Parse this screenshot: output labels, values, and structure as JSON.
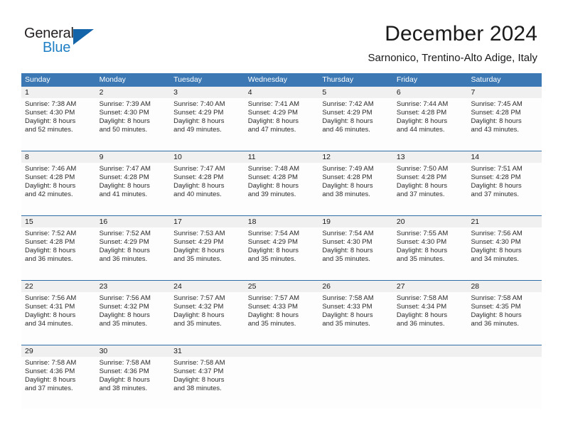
{
  "brand": {
    "name_part1": "General",
    "name_part2": "Blue",
    "triangle_icon": "blue-triangle-icon",
    "colors": {
      "dark": "#231f20",
      "blue": "#1f7fc4",
      "triangle": "#1464aa"
    }
  },
  "header": {
    "title": "December 2024",
    "subtitle": "Sarnonico, Trentino-Alto Adige, Italy"
  },
  "calendar": {
    "accent_color": "#3c79b4",
    "numberband_color": "#f0f0f0",
    "weekdays": [
      "Sunday",
      "Monday",
      "Tuesday",
      "Wednesday",
      "Thursday",
      "Friday",
      "Saturday"
    ],
    "weeks": [
      [
        {
          "day": "1",
          "sunrise": "Sunrise: 7:38 AM",
          "sunset": "Sunset: 4:30 PM",
          "daylight_line1": "Daylight: 8 hours",
          "daylight_line2": "and 52 minutes."
        },
        {
          "day": "2",
          "sunrise": "Sunrise: 7:39 AM",
          "sunset": "Sunset: 4:30 PM",
          "daylight_line1": "Daylight: 8 hours",
          "daylight_line2": "and 50 minutes."
        },
        {
          "day": "3",
          "sunrise": "Sunrise: 7:40 AM",
          "sunset": "Sunset: 4:29 PM",
          "daylight_line1": "Daylight: 8 hours",
          "daylight_line2": "and 49 minutes."
        },
        {
          "day": "4",
          "sunrise": "Sunrise: 7:41 AM",
          "sunset": "Sunset: 4:29 PM",
          "daylight_line1": "Daylight: 8 hours",
          "daylight_line2": "and 47 minutes."
        },
        {
          "day": "5",
          "sunrise": "Sunrise: 7:42 AM",
          "sunset": "Sunset: 4:29 PM",
          "daylight_line1": "Daylight: 8 hours",
          "daylight_line2": "and 46 minutes."
        },
        {
          "day": "6",
          "sunrise": "Sunrise: 7:44 AM",
          "sunset": "Sunset: 4:28 PM",
          "daylight_line1": "Daylight: 8 hours",
          "daylight_line2": "and 44 minutes."
        },
        {
          "day": "7",
          "sunrise": "Sunrise: 7:45 AM",
          "sunset": "Sunset: 4:28 PM",
          "daylight_line1": "Daylight: 8 hours",
          "daylight_line2": "and 43 minutes."
        }
      ],
      [
        {
          "day": "8",
          "sunrise": "Sunrise: 7:46 AM",
          "sunset": "Sunset: 4:28 PM",
          "daylight_line1": "Daylight: 8 hours",
          "daylight_line2": "and 42 minutes."
        },
        {
          "day": "9",
          "sunrise": "Sunrise: 7:47 AM",
          "sunset": "Sunset: 4:28 PM",
          "daylight_line1": "Daylight: 8 hours",
          "daylight_line2": "and 41 minutes."
        },
        {
          "day": "10",
          "sunrise": "Sunrise: 7:47 AM",
          "sunset": "Sunset: 4:28 PM",
          "daylight_line1": "Daylight: 8 hours",
          "daylight_line2": "and 40 minutes."
        },
        {
          "day": "11",
          "sunrise": "Sunrise: 7:48 AM",
          "sunset": "Sunset: 4:28 PM",
          "daylight_line1": "Daylight: 8 hours",
          "daylight_line2": "and 39 minutes."
        },
        {
          "day": "12",
          "sunrise": "Sunrise: 7:49 AM",
          "sunset": "Sunset: 4:28 PM",
          "daylight_line1": "Daylight: 8 hours",
          "daylight_line2": "and 38 minutes."
        },
        {
          "day": "13",
          "sunrise": "Sunrise: 7:50 AM",
          "sunset": "Sunset: 4:28 PM",
          "daylight_line1": "Daylight: 8 hours",
          "daylight_line2": "and 37 minutes."
        },
        {
          "day": "14",
          "sunrise": "Sunrise: 7:51 AM",
          "sunset": "Sunset: 4:28 PM",
          "daylight_line1": "Daylight: 8 hours",
          "daylight_line2": "and 37 minutes."
        }
      ],
      [
        {
          "day": "15",
          "sunrise": "Sunrise: 7:52 AM",
          "sunset": "Sunset: 4:28 PM",
          "daylight_line1": "Daylight: 8 hours",
          "daylight_line2": "and 36 minutes."
        },
        {
          "day": "16",
          "sunrise": "Sunrise: 7:52 AM",
          "sunset": "Sunset: 4:29 PM",
          "daylight_line1": "Daylight: 8 hours",
          "daylight_line2": "and 36 minutes."
        },
        {
          "day": "17",
          "sunrise": "Sunrise: 7:53 AM",
          "sunset": "Sunset: 4:29 PM",
          "daylight_line1": "Daylight: 8 hours",
          "daylight_line2": "and 35 minutes."
        },
        {
          "day": "18",
          "sunrise": "Sunrise: 7:54 AM",
          "sunset": "Sunset: 4:29 PM",
          "daylight_line1": "Daylight: 8 hours",
          "daylight_line2": "and 35 minutes."
        },
        {
          "day": "19",
          "sunrise": "Sunrise: 7:54 AM",
          "sunset": "Sunset: 4:30 PM",
          "daylight_line1": "Daylight: 8 hours",
          "daylight_line2": "and 35 minutes."
        },
        {
          "day": "20",
          "sunrise": "Sunrise: 7:55 AM",
          "sunset": "Sunset: 4:30 PM",
          "daylight_line1": "Daylight: 8 hours",
          "daylight_line2": "and 35 minutes."
        },
        {
          "day": "21",
          "sunrise": "Sunrise: 7:56 AM",
          "sunset": "Sunset: 4:30 PM",
          "daylight_line1": "Daylight: 8 hours",
          "daylight_line2": "and 34 minutes."
        }
      ],
      [
        {
          "day": "22",
          "sunrise": "Sunrise: 7:56 AM",
          "sunset": "Sunset: 4:31 PM",
          "daylight_line1": "Daylight: 8 hours",
          "daylight_line2": "and 34 minutes."
        },
        {
          "day": "23",
          "sunrise": "Sunrise: 7:56 AM",
          "sunset": "Sunset: 4:32 PM",
          "daylight_line1": "Daylight: 8 hours",
          "daylight_line2": "and 35 minutes."
        },
        {
          "day": "24",
          "sunrise": "Sunrise: 7:57 AM",
          "sunset": "Sunset: 4:32 PM",
          "daylight_line1": "Daylight: 8 hours",
          "daylight_line2": "and 35 minutes."
        },
        {
          "day": "25",
          "sunrise": "Sunrise: 7:57 AM",
          "sunset": "Sunset: 4:33 PM",
          "daylight_line1": "Daylight: 8 hours",
          "daylight_line2": "and 35 minutes."
        },
        {
          "day": "26",
          "sunrise": "Sunrise: 7:58 AM",
          "sunset": "Sunset: 4:33 PM",
          "daylight_line1": "Daylight: 8 hours",
          "daylight_line2": "and 35 minutes."
        },
        {
          "day": "27",
          "sunrise": "Sunrise: 7:58 AM",
          "sunset": "Sunset: 4:34 PM",
          "daylight_line1": "Daylight: 8 hours",
          "daylight_line2": "and 36 minutes."
        },
        {
          "day": "28",
          "sunrise": "Sunrise: 7:58 AM",
          "sunset": "Sunset: 4:35 PM",
          "daylight_line1": "Daylight: 8 hours",
          "daylight_line2": "and 36 minutes."
        }
      ],
      [
        {
          "day": "29",
          "sunrise": "Sunrise: 7:58 AM",
          "sunset": "Sunset: 4:36 PM",
          "daylight_line1": "Daylight: 8 hours",
          "daylight_line2": "and 37 minutes."
        },
        {
          "day": "30",
          "sunrise": "Sunrise: 7:58 AM",
          "sunset": "Sunset: 4:36 PM",
          "daylight_line1": "Daylight: 8 hours",
          "daylight_line2": "and 38 minutes."
        },
        {
          "day": "31",
          "sunrise": "Sunrise: 7:58 AM",
          "sunset": "Sunset: 4:37 PM",
          "daylight_line1": "Daylight: 8 hours",
          "daylight_line2": "and 38 minutes."
        },
        {
          "day": "",
          "sunrise": "",
          "sunset": "",
          "daylight_line1": "",
          "daylight_line2": ""
        },
        {
          "day": "",
          "sunrise": "",
          "sunset": "",
          "daylight_line1": "",
          "daylight_line2": ""
        },
        {
          "day": "",
          "sunrise": "",
          "sunset": "",
          "daylight_line1": "",
          "daylight_line2": ""
        },
        {
          "day": "",
          "sunrise": "",
          "sunset": "",
          "daylight_line1": "",
          "daylight_line2": ""
        }
      ]
    ]
  }
}
